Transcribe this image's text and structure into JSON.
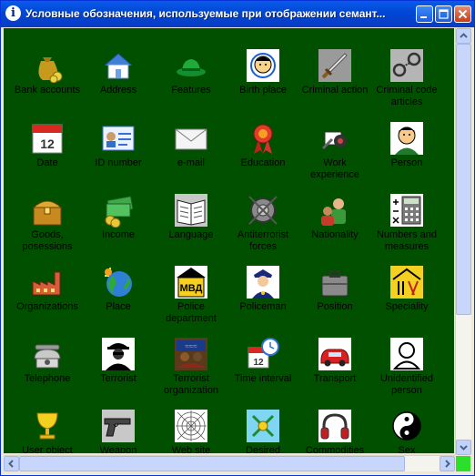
{
  "window": {
    "title": "Условные обозначения, используемые при отображении семант...",
    "info_icon_glyph": "i"
  },
  "items": [
    {
      "label": "Bank accounts",
      "icon": "money-bag-icon"
    },
    {
      "label": "Address",
      "icon": "house-icon"
    },
    {
      "label": "Features",
      "icon": "hat-icon"
    },
    {
      "label": "Birth place",
      "icon": "baby-face-icon"
    },
    {
      "label": "Criminal action",
      "icon": "sword-icon"
    },
    {
      "label": "Criminal code articles",
      "icon": "handcuffs-icon"
    },
    {
      "label": "Date",
      "icon": "calendar-icon"
    },
    {
      "label": "ID number",
      "icon": "id-card-icon"
    },
    {
      "label": "e-mail",
      "icon": "envelope-icon"
    },
    {
      "label": "Education",
      "icon": "medal-icon"
    },
    {
      "label": "Work experience",
      "icon": "tools-icon"
    },
    {
      "label": "Person",
      "icon": "person-face-icon"
    },
    {
      "label": "Goods, posessions",
      "icon": "treasure-chest-icon"
    },
    {
      "label": "Income",
      "icon": "cash-icon"
    },
    {
      "label": "Language",
      "icon": "book-icon"
    },
    {
      "label": "Antiterrorist forces",
      "icon": "shield-icon"
    },
    {
      "label": "Nationality",
      "icon": "people-icon"
    },
    {
      "label": "Numbers and measures",
      "icon": "calculator-icon"
    },
    {
      "label": "Organizations",
      "icon": "factory-icon"
    },
    {
      "label": "Place",
      "icon": "globe-icon"
    },
    {
      "label": "Police department",
      "icon": "police-station-icon"
    },
    {
      "label": "Policeman",
      "icon": "policeman-icon"
    },
    {
      "label": "Position",
      "icon": "briefcase-icon"
    },
    {
      "label": "Speciality",
      "icon": "speciality-tools-icon"
    },
    {
      "label": "Telephone",
      "icon": "telephone-icon"
    },
    {
      "label": "Terrorist",
      "icon": "terrorist-icon"
    },
    {
      "label": "Terrorist organization",
      "icon": "terrorist-group-icon"
    },
    {
      "label": "Time interval",
      "icon": "clock-calendar-icon"
    },
    {
      "label": "Transport",
      "icon": "car-icon"
    },
    {
      "label": "Unidentified person",
      "icon": "unknown-person-icon"
    },
    {
      "label": "User object",
      "icon": "cup-icon"
    },
    {
      "label": "Weapon",
      "icon": "pistol-icon"
    },
    {
      "label": "Web site",
      "icon": "spider-web-icon"
    },
    {
      "label": "Desired",
      "icon": "target-icon"
    },
    {
      "label": "Commodities",
      "icon": "headphones-icon"
    },
    {
      "label": "Sex",
      "icon": "yin-yang-icon"
    }
  ],
  "colors": {
    "client_bg": "#005000",
    "titlebar": "#0046D5",
    "scroll_corner": "#2BDF2B"
  }
}
